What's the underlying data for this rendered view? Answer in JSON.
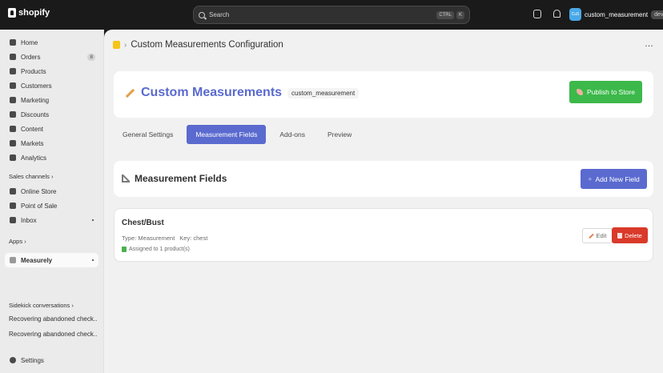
{
  "topbar": {
    "brand": "shopify",
    "search_placeholder": "Search",
    "shortcut_keys": [
      "CTRL",
      "K"
    ],
    "store_initials": "CuS",
    "store_name": "custom_measurement",
    "store_env": "dev"
  },
  "sidebar": {
    "items": [
      {
        "label": "Home",
        "icon": "home-icon"
      },
      {
        "label": "Orders",
        "icon": "orders-icon",
        "badge": "8"
      },
      {
        "label": "Products",
        "icon": "tag-icon"
      },
      {
        "label": "Customers",
        "icon": "person-icon"
      },
      {
        "label": "Marketing",
        "icon": "target-icon"
      },
      {
        "label": "Discounts",
        "icon": "discount-icon"
      },
      {
        "label": "Content",
        "icon": "content-icon"
      },
      {
        "label": "Markets",
        "icon": "globe-icon"
      },
      {
        "label": "Analytics",
        "icon": "chart-icon"
      }
    ],
    "sales_channels_label": "Sales channels",
    "sales_channels": [
      {
        "label": "Online Store",
        "icon": "store-icon"
      },
      {
        "label": "Point of Sale",
        "icon": "pos-icon"
      },
      {
        "label": "Inbox",
        "icon": "inbox-icon"
      }
    ],
    "apps_label": "Apps",
    "apps": [
      {
        "label": "Measurely",
        "icon": "app-icon"
      }
    ],
    "sidekick_label": "Sidekick conversations",
    "sidekick": [
      "Recovering abandoned check...",
      "Recovering abandoned check..."
    ],
    "settings_label": "Settings"
  },
  "header": {
    "breadcrumb_title": "Custom Measurements Configuration",
    "more_label": "…"
  },
  "hero": {
    "title": "Custom Measurements",
    "tag": "custom_measurement",
    "publish_label": "Publish to Store"
  },
  "tabs": [
    {
      "label": "General Settings",
      "active": false
    },
    {
      "label": "Measurement Fields",
      "active": true
    },
    {
      "label": "Add-ons",
      "active": false
    },
    {
      "label": "Preview",
      "active": false
    }
  ],
  "fields_section": {
    "title": "Measurement Fields",
    "add_label": "Add New Field"
  },
  "field": {
    "name": "Chest/Bust",
    "type_text": "Type: Measurement",
    "key_text": "Key: chest",
    "assigned_text": "Assigned to 1 product(s)",
    "edit_label": "Edit",
    "delete_label": "Delete"
  },
  "colors": {
    "accent": "#5a6acf",
    "publish": "#3cb94a",
    "danger": "#d93a2a"
  }
}
